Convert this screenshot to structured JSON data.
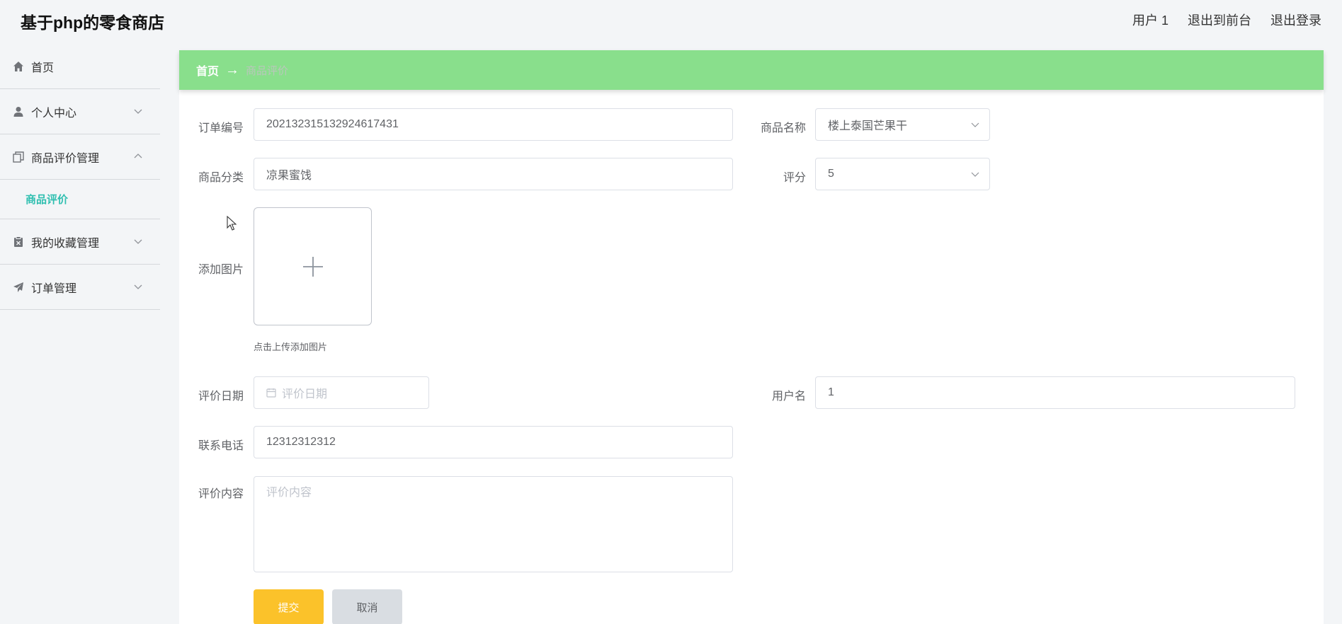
{
  "header": {
    "title": "基于php的零食商店",
    "user_label": "用户 1",
    "to_front_label": "退出到前台",
    "logout_label": "退出登录"
  },
  "sidebar": {
    "items": [
      {
        "label": "首页",
        "icon": "home-icon"
      },
      {
        "label": "个人中心",
        "icon": "user-icon"
      },
      {
        "label": "商品评价管理",
        "icon": "copy-icon",
        "expanded": true
      },
      {
        "label": "我的收藏管理",
        "icon": "clipboard-icon"
      },
      {
        "label": "订单管理",
        "icon": "send-icon"
      }
    ],
    "subitem": "商品评价"
  },
  "breadcrumb": {
    "home": "首页",
    "current": "商品评价"
  },
  "form": {
    "order_no_label": "订单编号",
    "order_no_value": "20213231513292461743​1",
    "product_name_label": "商品名称",
    "product_name_value": "楼上泰国芒果干",
    "category_label": "商品分类",
    "category_value": "凉果蜜饯",
    "rating_label": "评分",
    "rating_value": "5",
    "add_image_label": "添加图片",
    "upload_hint": "点击上传添加图片",
    "review_date_label": "评价日期",
    "review_date_placeholder": "评价日期",
    "username_label": "用户名",
    "username_value": "1",
    "phone_label": "联系电话",
    "phone_value": "12312312312",
    "content_label": "评价内容",
    "content_placeholder": "评价内容",
    "submit_label": "提交",
    "cancel_label": "取消"
  },
  "colors": {
    "breadcrumb_bg": "#89df8c",
    "accent": "#2fbfb0",
    "submit": "#fbc22a",
    "cancel": "#d9dde2"
  }
}
